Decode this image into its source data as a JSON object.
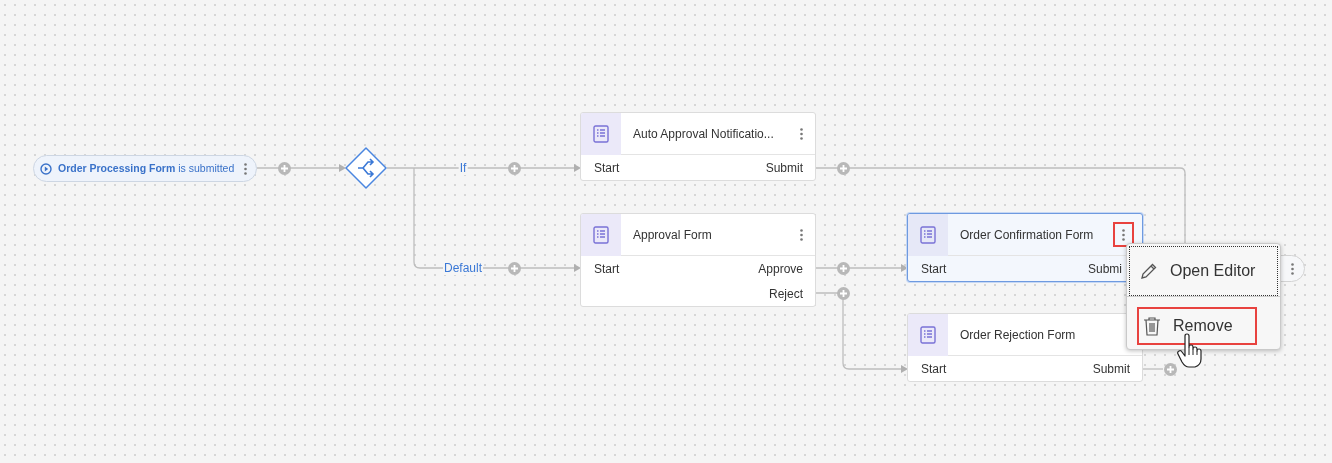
{
  "trigger": {
    "text": "**Order Processing Form** is submitted"
  },
  "branches": [
    {
      "label": "If"
    },
    {
      "label": "Default"
    }
  ],
  "forms": [
    {
      "title": "Auto Approval Notificatio...",
      "selected": false,
      "menu_highlighted": false,
      "input": "Start",
      "outputs": [
        "Submit"
      ]
    },
    {
      "title": "Approval Form",
      "selected": false,
      "menu_highlighted": false,
      "input": "Start",
      "outputs": [
        "Approve",
        "Reject"
      ]
    },
    {
      "title": "Order Confirmation Form",
      "selected": true,
      "menu_highlighted": true,
      "input": "Start",
      "outputs": [
        "Submi"
      ]
    },
    {
      "title": "Order Rejection Form",
      "selected": false,
      "input": "Start",
      "outputs": [
        "Submit"
      ]
    }
  ],
  "context_menu": {
    "items": [
      {
        "kind": "edit",
        "label": "Open Editor",
        "focused": true,
        "highlighted": false
      },
      {
        "kind": "delete",
        "label": "Remove",
        "focused": false,
        "highlighted": true
      }
    ]
  }
}
